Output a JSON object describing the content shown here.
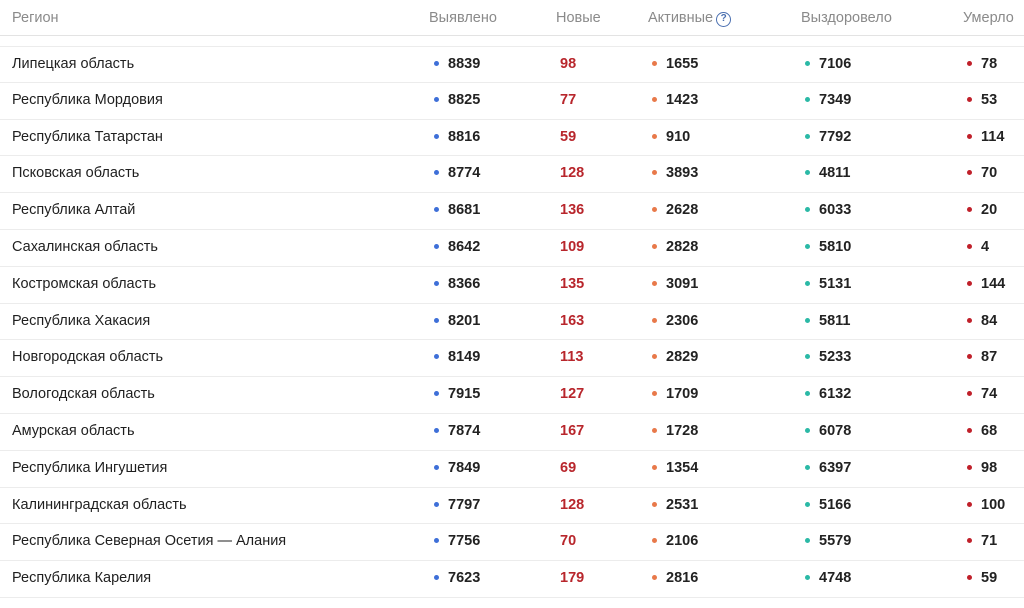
{
  "colors": {
    "found": "#3e6fd8",
    "new": "#b8262c",
    "active": "#e8794a",
    "recovered": "#2bb9a6",
    "deaths": "#c0202a"
  },
  "header": {
    "region": "Регион",
    "found": "Выявлено",
    "new": "Новые",
    "active": "Активные",
    "help_icon": "?",
    "recovered": "Выздоровело",
    "deaths": "Умерло"
  },
  "rows": [
    {
      "region": "Липецкая область",
      "found": "8839",
      "new": "98",
      "active": "1655",
      "recovered": "7106",
      "deaths": "78"
    },
    {
      "region": "Республика Мордовия",
      "found": "8825",
      "new": "77",
      "active": "1423",
      "recovered": "7349",
      "deaths": "53"
    },
    {
      "region": "Республика Татарстан",
      "found": "8816",
      "new": "59",
      "active": "910",
      "recovered": "7792",
      "deaths": "114"
    },
    {
      "region": "Псковская область",
      "found": "8774",
      "new": "128",
      "active": "3893",
      "recovered": "4811",
      "deaths": "70"
    },
    {
      "region": "Республика Алтай",
      "found": "8681",
      "new": "136",
      "active": "2628",
      "recovered": "6033",
      "deaths": "20"
    },
    {
      "region": "Сахалинская область",
      "found": "8642",
      "new": "109",
      "active": "2828",
      "recovered": "5810",
      "deaths": "4"
    },
    {
      "region": "Костромская область",
      "found": "8366",
      "new": "135",
      "active": "3091",
      "recovered": "5131",
      "deaths": "144"
    },
    {
      "region": "Республика Хакасия",
      "found": "8201",
      "new": "163",
      "active": "2306",
      "recovered": "5811",
      "deaths": "84"
    },
    {
      "region": "Новгородская область",
      "found": "8149",
      "new": "113",
      "active": "2829",
      "recovered": "5233",
      "deaths": "87"
    },
    {
      "region": "Вологодская область",
      "found": "7915",
      "new": "127",
      "active": "1709",
      "recovered": "6132",
      "deaths": "74"
    },
    {
      "region": "Амурская область",
      "found": "7874",
      "new": "167",
      "active": "1728",
      "recovered": "6078",
      "deaths": "68"
    },
    {
      "region": "Республика Ингушетия",
      "found": "7849",
      "new": "69",
      "active": "1354",
      "recovered": "6397",
      "deaths": "98"
    },
    {
      "region": "Калининградская область",
      "found": "7797",
      "new": "128",
      "active": "2531",
      "recovered": "5166",
      "deaths": "100"
    },
    {
      "region": "Республика Северная Осетия — Алания",
      "found": "7756",
      "new": "70",
      "active": "2106",
      "recovered": "5579",
      "deaths": "71"
    },
    {
      "region": "Республика Карелия",
      "found": "7623",
      "new": "179",
      "active": "2816",
      "recovered": "4748",
      "deaths": "59"
    }
  ]
}
